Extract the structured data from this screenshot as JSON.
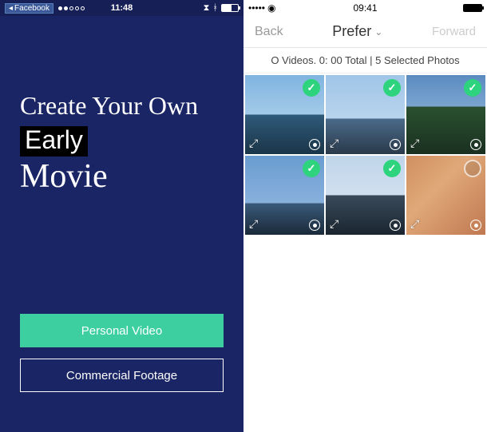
{
  "left": {
    "statusbar": {
      "back_app": "Facebook",
      "time": "11:48"
    },
    "hero": {
      "line1": "Create Your Own",
      "line2": "Early",
      "line3": "Movie"
    },
    "buttons": {
      "personal": "Personal Video",
      "commercial": "Commercial Footage"
    }
  },
  "right": {
    "statusbar": {
      "time": "09:41"
    },
    "nav": {
      "back": "Back",
      "title": "Prefer",
      "forward": "Forward"
    },
    "info": "O Videos. 0: 00 Total | 5 Selected Photos",
    "thumbs": [
      {
        "name": "photo-1",
        "selected": true,
        "cls": "sky1"
      },
      {
        "name": "photo-2",
        "selected": true,
        "cls": "sky2"
      },
      {
        "name": "photo-3",
        "selected": true,
        "cls": "sky3"
      },
      {
        "name": "photo-4",
        "selected": true,
        "cls": "sky4"
      },
      {
        "name": "photo-5",
        "selected": true,
        "cls": "sky5"
      },
      {
        "name": "photo-6",
        "selected": false,
        "cls": "cat"
      }
    ],
    "icons": {
      "check": "✓"
    }
  }
}
